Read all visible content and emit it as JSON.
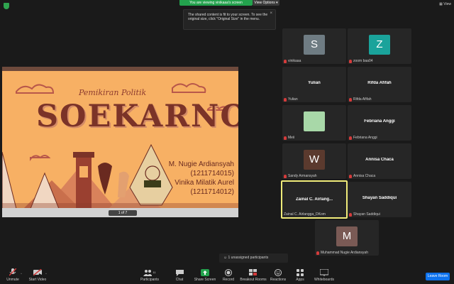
{
  "banner": {
    "viewing_text": "You are viewing vinikaaa's screen",
    "view_options": "View Options ▾",
    "view_button": "View"
  },
  "notice": {
    "text": "The shared content is fit to your screen. To see the original size, click \"Original Size\" in the menu.",
    "close": "×"
  },
  "slide": {
    "subtitle": "Pemikiran Politik",
    "title": "SOEKARNO",
    "presenters": [
      {
        "name": "M. Nugie Ardiansyah",
        "id": "(1211714015)"
      },
      {
        "name": "Vinika Milatik Aurel",
        "id": "(1211714012)"
      }
    ],
    "page_indicator": "1 of 7"
  },
  "participants": [
    {
      "label": "vinikaaa",
      "avatar": "S",
      "avatar_color": "#6f7c83"
    },
    {
      "label": "zoom baa04",
      "avatar": "Z",
      "avatar_color": "#1aa39b"
    },
    {
      "label": "Yulian",
      "center_name": "Yulian"
    },
    {
      "label": "Rifda Afifah",
      "center_name": "Rifda Afifah"
    },
    {
      "label": "Meii",
      "avatar_color": "#a8d8a8"
    },
    {
      "label": "Febriana Anggi",
      "center_name": "Febriana Anggi"
    },
    {
      "label": "Sandy Armansyah",
      "avatar": "W",
      "avatar_color": "#5b3a2e"
    },
    {
      "label": "Annisa Chaca",
      "center_name": "Annisa Chaca"
    },
    {
      "label": "Zainal C. Airlangga_DKom",
      "center_name": "Zainal C. Airlang...",
      "active": true
    },
    {
      "label": "Shayan Saddiqui",
      "center_name": "Shayan Saddiqui"
    },
    {
      "label": "Muhammad Nugie Ardiansyah",
      "avatar": "M",
      "avatar_color": "#7a5a55"
    }
  ],
  "unassigned": "1 unassigned participants",
  "toolbar": {
    "unmute": "Unmute",
    "start_video": "Start Video",
    "participants": "Participants",
    "participants_count": "11",
    "chat": "Chat",
    "share_screen": "Share Screen",
    "record": "Record",
    "breakout_rooms": "Breakout Rooms",
    "reactions": "Reactions",
    "apps": "Apps",
    "whiteboards": "Whiteboards",
    "leave": "Leave Room"
  },
  "colors": {
    "share_green": "#23a24d",
    "leave_blue": "#0e72ed",
    "active_speaker": "#f0ec7a",
    "muted_red": "#d43b3b",
    "slide_bg": "#f7b064",
    "slide_title": "#7b3328"
  }
}
